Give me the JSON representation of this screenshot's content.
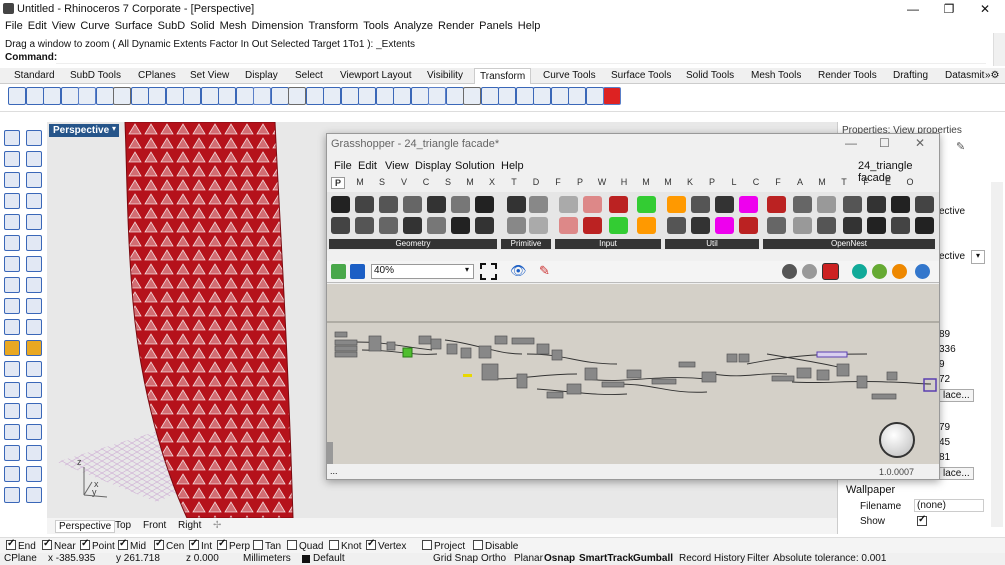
{
  "app": {
    "title": "Untitled - Rhinoceros 7 Corporate - [Perspective]",
    "window_controls": [
      "—",
      "❐",
      "✕"
    ]
  },
  "menu": [
    "File",
    "Edit",
    "View",
    "Curve",
    "Surface",
    "SubD",
    "Solid",
    "Mesh",
    "Dimension",
    "Transform",
    "Tools",
    "Analyze",
    "Render",
    "Panels",
    "Help"
  ],
  "command": {
    "history": "Drag a window to zoom ( All  Dynamic  Extents  Factor  In  Out  Selected  Target  1To1 ): _Extents",
    "prompt": "Command:"
  },
  "toolbar_tabs": [
    "Standard",
    "SubD Tools",
    "CPlanes",
    "Set View",
    "Display",
    "Select",
    "Viewport Layout",
    "Visibility",
    "Transform",
    "Curve Tools",
    "Surface Tools",
    "Solid Tools",
    "Mesh Tools",
    "Render Tools",
    "Drafting",
    "Datasmit"
  ],
  "toolbar_tab_active": "Transform",
  "viewport": {
    "label": "Perspective",
    "axis_z": "z",
    "axis_x": "x",
    "axis_y": "y"
  },
  "viewport_tabs": [
    "Perspective",
    "Top",
    "Front",
    "Right"
  ],
  "properties": {
    "header": "Properties: View properties",
    "vals": [
      "ective",
      "ective",
      "89",
      "336",
      "9",
      "72",
      "lace...",
      "79",
      "45",
      "81",
      "lace..."
    ],
    "wallpaper_title": "Wallpaper",
    "filename_label": "Filename",
    "filename_value": "(none)",
    "show_label": "Show"
  },
  "osnaps": [
    {
      "label": "End",
      "on": true
    },
    {
      "label": "Near",
      "on": true
    },
    {
      "label": "Point",
      "on": true
    },
    {
      "label": "Mid",
      "on": true
    },
    {
      "label": "Cen",
      "on": true
    },
    {
      "label": "Int",
      "on": true
    },
    {
      "label": "Perp",
      "on": true
    },
    {
      "label": "Tan",
      "on": false
    },
    {
      "label": "Quad",
      "on": false
    },
    {
      "label": "Knot",
      "on": false
    },
    {
      "label": "Vertex",
      "on": true
    },
    {
      "label": "Project",
      "on": false
    },
    {
      "label": "Disable",
      "on": false
    }
  ],
  "status": {
    "cplane": "CPlane",
    "x": "x -385.935",
    "y": "y 261.718",
    "z": "z 0.000",
    "units": "Millimeters",
    "layer": "Default",
    "grid_snap": "Grid Snap",
    "ortho": "Ortho",
    "planar": "Planar",
    "osnap": "Osnap",
    "smarttrack": "SmartTrack",
    "gumball": "Gumball",
    "record": "Record History",
    "filter": "Filter",
    "tolerance": "Absolute tolerance: 0.001"
  },
  "grasshopper": {
    "title": "Grasshopper - 24_triangle facade*",
    "doc_name": "24_triangle facade",
    "menu": [
      "File",
      "Edit",
      "View",
      "Display",
      "Solution",
      "Help"
    ],
    "tabs": [
      "P",
      "M",
      "S",
      "V",
      "C",
      "S",
      "M",
      "X",
      "T",
      "D",
      "F",
      "P",
      "W",
      "H",
      "M",
      "M",
      "K",
      "P",
      "L",
      "C",
      "F",
      "A",
      "M",
      "T",
      "F",
      "E",
      "O"
    ],
    "groups": [
      "Geometry",
      "Primitive",
      "Input",
      "Util",
      "OpenNest"
    ],
    "zoom": "40%",
    "version": "1.0.0007",
    "ellipsis": "..."
  },
  "colors": {
    "facade_red": "#b5121b",
    "viewport_bg": "#e8e8e8",
    "gh_canvas": "#d4d0c8",
    "vp_label_bg": "#26558a"
  }
}
